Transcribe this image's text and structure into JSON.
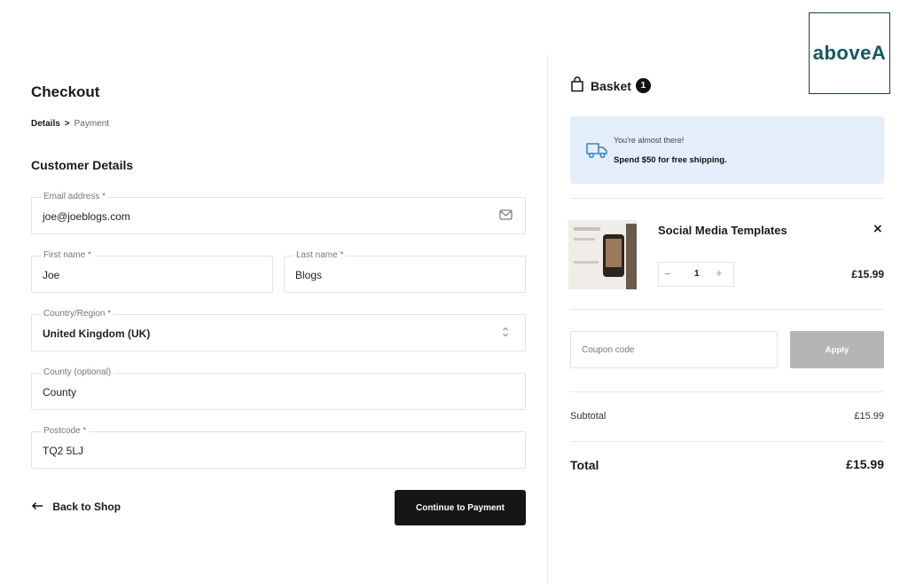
{
  "logo": {
    "text": "aboveA"
  },
  "checkout": {
    "title": "Checkout",
    "breadcrumb": {
      "current": "Details",
      "separator": ">",
      "next": "Payment"
    },
    "section_title": "Customer Details",
    "fields": {
      "email": {
        "label": "Email address *",
        "value": "joe@joeblogs.com",
        "icon": "envelope-icon"
      },
      "first_name": {
        "label": "First name *",
        "value": "Joe"
      },
      "last_name": {
        "label": "Last name *",
        "value": "Blogs"
      },
      "country": {
        "label": "Country/Region *",
        "value": "United Kingdom (UK)",
        "icon": "select-arrows-icon"
      },
      "county": {
        "label": "County (optional)",
        "value": "County"
      },
      "postcode": {
        "label": "Postcode *",
        "value": "TQ2 5LJ"
      }
    },
    "back_link": "Back to Shop",
    "continue_button": "Continue to Payment"
  },
  "basket": {
    "title": "Basket",
    "count": "1",
    "notice": {
      "line1": "You're almost there!",
      "line2": "Spend $50 for free shipping."
    },
    "item": {
      "name": "Social Media Templates",
      "quantity": "1",
      "price": "£15.99",
      "remove": "×"
    },
    "coupon": {
      "placeholder": "Coupon code",
      "apply_label": "Apply"
    },
    "subtotal": {
      "label": "Subtotal",
      "value": "£15.99"
    },
    "total": {
      "label": "Total",
      "value": "£15.99"
    }
  },
  "colors": {
    "notice_bg": "#e3eefa",
    "primary_button": "#161616",
    "apply_disabled": "#b5b5b5",
    "logo_text": "#15595c",
    "truck_icon": "#3a86c8"
  }
}
